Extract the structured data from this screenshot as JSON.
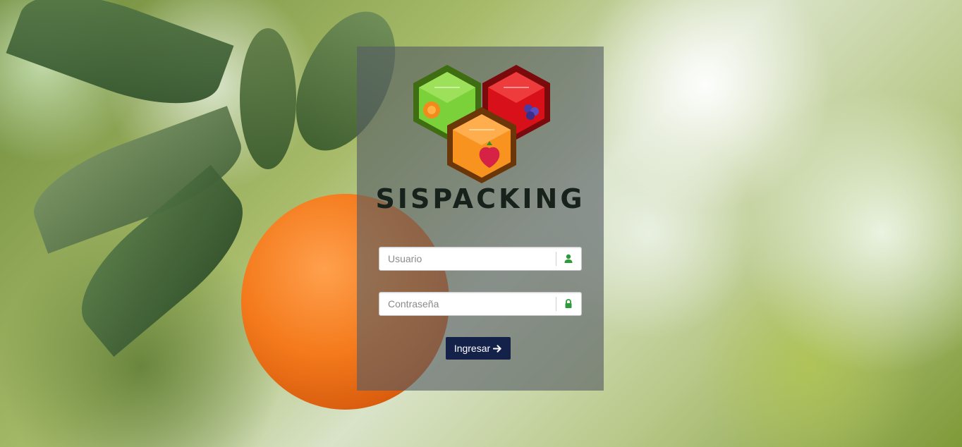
{
  "brand": {
    "name": "SISPACKING"
  },
  "login": {
    "username_placeholder": "Usuario",
    "password_placeholder": "Contraseña",
    "submit_label": "Ingresar"
  },
  "icons": {
    "username": "user-icon",
    "password": "lock-icon",
    "submit": "arrow-right-icon"
  },
  "colors": {
    "button": "#14224a",
    "icon_green": "#2e9b3a",
    "logo_green": "#7bd13a",
    "logo_red": "#d8101a",
    "logo_orange": "#f7931e"
  }
}
